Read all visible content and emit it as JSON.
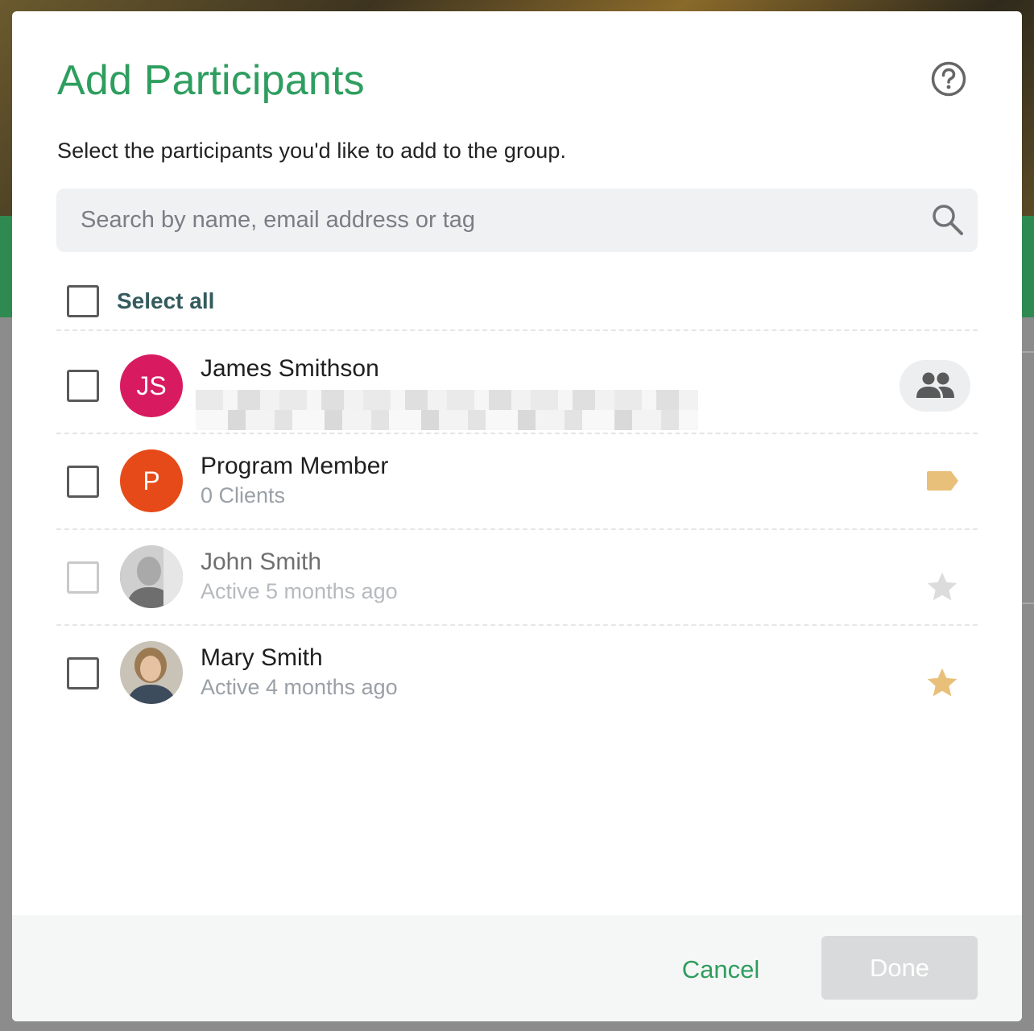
{
  "dialog": {
    "title": "Add Participants",
    "subtitle": "Select the participants you'd like to add to the group.",
    "help_icon": "question-circle-icon"
  },
  "search": {
    "placeholder": "Search by name, email address or tag",
    "value": "",
    "icon": "search-icon"
  },
  "select_all": {
    "label": "Select all",
    "checked": false
  },
  "participants": [
    {
      "name": "James Smithson",
      "initials": "JS",
      "avatar_color": "#d81b60",
      "detail": "",
      "checked": false,
      "disabled": false,
      "badge_icon": "group-icon"
    },
    {
      "name": "Program Member",
      "initials": "P",
      "avatar_color": "#e64a19",
      "detail": "0 Clients",
      "checked": false,
      "disabled": false,
      "badge_icon": "tag-icon"
    },
    {
      "name": "John Smith",
      "initials": "",
      "detail": "Active 5 months ago",
      "checked": false,
      "disabled": true,
      "badge_icon": "star-outline-icon"
    },
    {
      "name": "Mary Smith",
      "initials": "",
      "detail": "Active 4 months ago",
      "checked": false,
      "disabled": false,
      "badge_icon": "star-filled-icon"
    }
  ],
  "footer": {
    "cancel_label": "Cancel",
    "done_label": "Done"
  },
  "colors": {
    "accent": "#2e9e5f",
    "star": "#e8c07a",
    "tag": "#e8c07a"
  }
}
